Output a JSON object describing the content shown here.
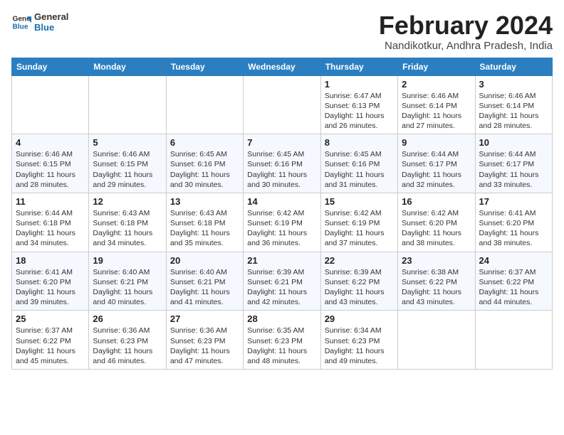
{
  "logo": {
    "line1": "General",
    "line2": "Blue"
  },
  "title": "February 2024",
  "location": "Nandikotkur, Andhra Pradesh, India",
  "days_header": [
    "Sunday",
    "Monday",
    "Tuesday",
    "Wednesday",
    "Thursday",
    "Friday",
    "Saturday"
  ],
  "weeks": [
    [
      {
        "day": "",
        "info": ""
      },
      {
        "day": "",
        "info": ""
      },
      {
        "day": "",
        "info": ""
      },
      {
        "day": "",
        "info": ""
      },
      {
        "day": "1",
        "info": "Sunrise: 6:47 AM\nSunset: 6:13 PM\nDaylight: 11 hours\nand 26 minutes."
      },
      {
        "day": "2",
        "info": "Sunrise: 6:46 AM\nSunset: 6:14 PM\nDaylight: 11 hours\nand 27 minutes."
      },
      {
        "day": "3",
        "info": "Sunrise: 6:46 AM\nSunset: 6:14 PM\nDaylight: 11 hours\nand 28 minutes."
      }
    ],
    [
      {
        "day": "4",
        "info": "Sunrise: 6:46 AM\nSunset: 6:15 PM\nDaylight: 11 hours\nand 28 minutes."
      },
      {
        "day": "5",
        "info": "Sunrise: 6:46 AM\nSunset: 6:15 PM\nDaylight: 11 hours\nand 29 minutes."
      },
      {
        "day": "6",
        "info": "Sunrise: 6:45 AM\nSunset: 6:16 PM\nDaylight: 11 hours\nand 30 minutes."
      },
      {
        "day": "7",
        "info": "Sunrise: 6:45 AM\nSunset: 6:16 PM\nDaylight: 11 hours\nand 30 minutes."
      },
      {
        "day": "8",
        "info": "Sunrise: 6:45 AM\nSunset: 6:16 PM\nDaylight: 11 hours\nand 31 minutes."
      },
      {
        "day": "9",
        "info": "Sunrise: 6:44 AM\nSunset: 6:17 PM\nDaylight: 11 hours\nand 32 minutes."
      },
      {
        "day": "10",
        "info": "Sunrise: 6:44 AM\nSunset: 6:17 PM\nDaylight: 11 hours\nand 33 minutes."
      }
    ],
    [
      {
        "day": "11",
        "info": "Sunrise: 6:44 AM\nSunset: 6:18 PM\nDaylight: 11 hours\nand 34 minutes."
      },
      {
        "day": "12",
        "info": "Sunrise: 6:43 AM\nSunset: 6:18 PM\nDaylight: 11 hours\nand 34 minutes."
      },
      {
        "day": "13",
        "info": "Sunrise: 6:43 AM\nSunset: 6:18 PM\nDaylight: 11 hours\nand 35 minutes."
      },
      {
        "day": "14",
        "info": "Sunrise: 6:42 AM\nSunset: 6:19 PM\nDaylight: 11 hours\nand 36 minutes."
      },
      {
        "day": "15",
        "info": "Sunrise: 6:42 AM\nSunset: 6:19 PM\nDaylight: 11 hours\nand 37 minutes."
      },
      {
        "day": "16",
        "info": "Sunrise: 6:42 AM\nSunset: 6:20 PM\nDaylight: 11 hours\nand 38 minutes."
      },
      {
        "day": "17",
        "info": "Sunrise: 6:41 AM\nSunset: 6:20 PM\nDaylight: 11 hours\nand 38 minutes."
      }
    ],
    [
      {
        "day": "18",
        "info": "Sunrise: 6:41 AM\nSunset: 6:20 PM\nDaylight: 11 hours\nand 39 minutes."
      },
      {
        "day": "19",
        "info": "Sunrise: 6:40 AM\nSunset: 6:21 PM\nDaylight: 11 hours\nand 40 minutes."
      },
      {
        "day": "20",
        "info": "Sunrise: 6:40 AM\nSunset: 6:21 PM\nDaylight: 11 hours\nand 41 minutes."
      },
      {
        "day": "21",
        "info": "Sunrise: 6:39 AM\nSunset: 6:21 PM\nDaylight: 11 hours\nand 42 minutes."
      },
      {
        "day": "22",
        "info": "Sunrise: 6:39 AM\nSunset: 6:22 PM\nDaylight: 11 hours\nand 43 minutes."
      },
      {
        "day": "23",
        "info": "Sunrise: 6:38 AM\nSunset: 6:22 PM\nDaylight: 11 hours\nand 43 minutes."
      },
      {
        "day": "24",
        "info": "Sunrise: 6:37 AM\nSunset: 6:22 PM\nDaylight: 11 hours\nand 44 minutes."
      }
    ],
    [
      {
        "day": "25",
        "info": "Sunrise: 6:37 AM\nSunset: 6:22 PM\nDaylight: 11 hours\nand 45 minutes."
      },
      {
        "day": "26",
        "info": "Sunrise: 6:36 AM\nSunset: 6:23 PM\nDaylight: 11 hours\nand 46 minutes."
      },
      {
        "day": "27",
        "info": "Sunrise: 6:36 AM\nSunset: 6:23 PM\nDaylight: 11 hours\nand 47 minutes."
      },
      {
        "day": "28",
        "info": "Sunrise: 6:35 AM\nSunset: 6:23 PM\nDaylight: 11 hours\nand 48 minutes."
      },
      {
        "day": "29",
        "info": "Sunrise: 6:34 AM\nSunset: 6:23 PM\nDaylight: 11 hours\nand 49 minutes."
      },
      {
        "day": "",
        "info": ""
      },
      {
        "day": "",
        "info": ""
      }
    ]
  ]
}
